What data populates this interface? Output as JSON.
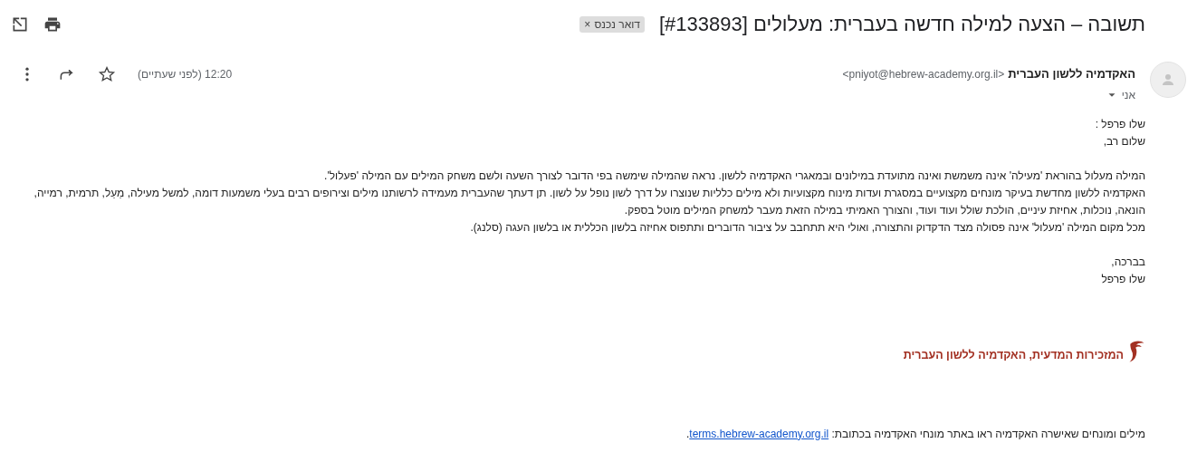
{
  "subject": {
    "title": "תשובה – הצעה למילה חדשה בעברית: מעלולים [#133893]",
    "label": {
      "text": "דואר נכנס",
      "close": "×"
    }
  },
  "message": {
    "sender_name": "האקדמיה ללשון העברית",
    "sender_email": "<pniyot@hebrew-academy.org.il>",
    "recipient": "אני",
    "time": "12:20 (לפני שעתיים)",
    "starred": false
  },
  "body": {
    "greeting": [
      "שלו פרפל :",
      "שלום רב,"
    ],
    "paragraph": [
      "המילה מעלול בהוראת 'מעילה' אינה משמשת ואינה מתועדת במילונים ובמאגרי האקדמיה ללשון. נראה שהמילה שימשה בפי הדובר לצורך השעה ולשם משחק המילים עם המילה 'פעלול'.",
      "האקדמיה ללשון מחדשת בעיקר מונחים מקצועיים במסגרת ועדות מינוח מקצועיות ולא מילים כלליות שנוצרו על דרך לשון נופל על לשון. תן דעתך שהעברית מעמידה לרשותנו מילים וצירופים רבים בעלי משמעות דומה, למשל מעילה, מַעַל, תרמית, רמייה,",
      "הונאה, נוכלות, אחיזת עיניים, הולכת שולל ועוד ועוד, והצורך האמיתי במילה הזאת מעבר למשחק המילים מוטל בספק.",
      "מכל מקום המילה 'מעלול' אינה פסולה מצד הדקדוק והתצורה, ואולי היא תתחבב על ציבור הדוברים ותתפוס אחיזה בלשון הכללית או בלשון העגה (סלנג)."
    ],
    "closing": [
      "בברכה,",
      "שלו פרפל"
    ],
    "signature": "המזכירות המדעית, האקדמיה ללשון העברית",
    "footer": {
      "text": "מילים ומונחים שאישרה האקדמיה ראו באתר מונחי האקדמיה בכתובת:",
      "link": "terms.hebrew-academy.org.il",
      "end": "."
    }
  }
}
